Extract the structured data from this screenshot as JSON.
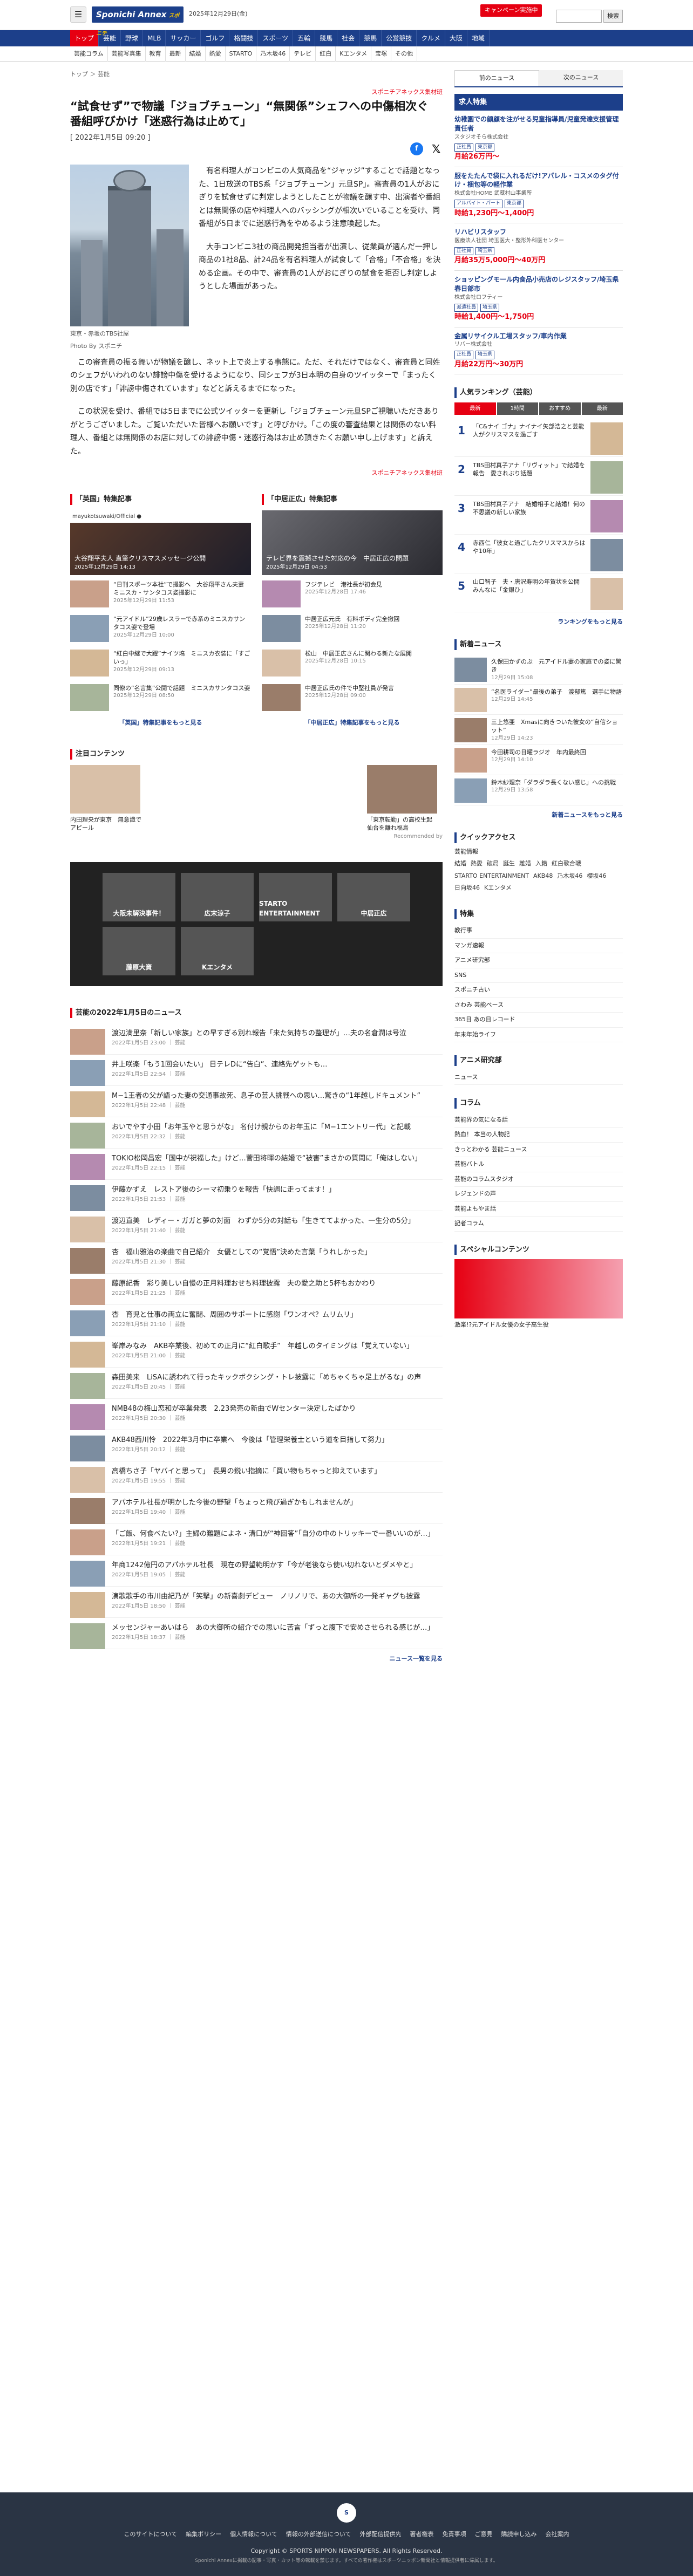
{
  "header": {
    "menu_icon": "☰",
    "logo": "Sponichi Annex",
    "logo_sub": "スポニチ",
    "date": "2025年12月29日(金)",
    "campaign": "キャンペーン実施中",
    "search_btn": "検索"
  },
  "nav": [
    "トップ",
    "芸能",
    "野球",
    "MLB",
    "サッカー",
    "ゴルフ",
    "格闘技",
    "スポーツ",
    "五輪",
    "競馬",
    "社会",
    "競馬",
    "公営競技",
    "クルメ",
    "大阪",
    "地域"
  ],
  "subnav": [
    "芸能コラム",
    "芸能写真集",
    "教育",
    "最新",
    "結婚",
    "熱愛",
    "STARTO",
    "乃木坂46",
    "テレビ",
    "紅白",
    "Kエンタメ",
    "宝塚",
    "その他"
  ],
  "breadcrumb": "トップ ＞ 芸能",
  "sponsor": "スポニチアネックス集材班",
  "title": "“試食せず”で物議「ジョブチューン」“無関係”シェフへの中傷相次ぐ　番組呼びかけ「迷惑行為は止めて」",
  "pubdate": "[ 2022年1月5日 09:20 ]",
  "photo_caption": "東京・赤坂のTBS社屋",
  "photo_credit": "Photo By スポニチ",
  "paras": [
    "有名料理人がコンビニの人気商品を“ジャッジ”することで話題となった、1日放送のTBS系「ジョブチューン」元旦SP」。審査員の1人がおにぎりを試食せずに判定しようとしたことが物議を醸す中、出演者や番組とは無関係の店や料理人へのバッシングが相次いでいることを受け、同番組が5日までに迷惑行為をやめるよう注意喚起した。",
    "大手コンビニ3社の商品開発担当者が出演し、従業員が選んだ一押し商品の1社8品、計24品を有名料理人が試食して「合格」「不合格」を決める企画。その中で、審査員の1人がおにぎりの試食を拒否し判定しようとした場面があった。",
    "この審査員の振る舞いが物議を醸し、ネット上で炎上する事態に。ただ、それだけではなく、審査員と同姓のシェフがいわれのない誹謗中傷を受けるようになり、同シェフが3日本明の自身のツイッターで「まったく別の店です」「誹謗中傷されています」などと訴えるまでになった。",
    "この状況を受け、番組では5日までに公式ツイッターを更新し「ジョブチューン元旦SPご視聴いただきありがとうございました。ご覧いただいた皆様へお願いです」と呼びかけ。「この度の審査結果とは関係のない料理人、番組とは無関係のお店に対しての誹謗中傷・迷惑行為はお止め頂きたくお願い申し上げます」と訴えた。"
  ],
  "left_col": {
    "head": "「英国」特集記事",
    "hero": "大谷翔平夫人 直筆クリスマスメッセージ公開",
    "hero_date": "2025年12月29日 14:13",
    "items": [
      {
        "t": "“日刊スポーツ本社”で撮影へ　大谷翔平さん夫妻　ミニスカ・サンタコス姿撮影に",
        "d": "2025年12月29日 11:53"
      },
      {
        "t": "“元アイドル”29歳レスラーで赤系のミニスカサンタコス姿で登場",
        "d": "2025年12月29日 10:00"
      },
      {
        "t": "“紅白中継で大躍”ナイツ塙　ミニスカ衣装に「すごいっ」",
        "d": "2025年12月29日 09:13"
      },
      {
        "t": "同僚の“名言集”公開で話題　ミニスカサンタコス姿",
        "d": "2025年12月29日 08:50"
      }
    ],
    "more": "「英国」特集記事をもっと見る"
  },
  "right_col": {
    "head": "「中居正広」特集記事",
    "hero": "テレビ界を震撼させた対応の今　中居正広の問題",
    "hero_date": "2025年12月29日 04:53",
    "items": [
      {
        "t": "フジテレビ　港社長が初会見",
        "d": "2025年12月28日 17:46"
      },
      {
        "t": "中居正広元氏　有料ボディ完全撤回",
        "d": "2025年12月28日 11:20"
      },
      {
        "t": "松山　中居正広さんに関わる新たな展開",
        "d": "2025年12月28日 10:15"
      },
      {
        "t": "中居正広氏の件で中堅社員が発言",
        "d": "2025年12月28日 09:00"
      }
    ],
    "more": "「中居正広」特集記事をもっと見る"
  },
  "attention": {
    "head": "注目コンテンツ",
    "left": "内田理央が東京　無意識でアピール",
    "right": "「東京転勤」の高校生起　仙台を離れ福島",
    "credit": "Recommended by"
  },
  "gallery": [
    "大阪未解決事件！",
    "広末涼子",
    "STARTO ENTERTAINMENT",
    "中居正広",
    "藤原大資",
    "Kエンタメ"
  ],
  "news_head": "芸能の2022年1月5日のニュース",
  "news": [
    {
      "t": "渡辺満里奈「新しい家族」との早すぎる別れ報告「来た気持ちの整理が」…夫の名倉潤は号泣",
      "d": "2022年1月5日 23:00 ｜ 芸能"
    },
    {
      "t": "井上咲楽「もう1回会いたい」 日テレDに“告白”、連絡先ゲットも…",
      "d": "2022年1月5日 22:54 ｜ 芸能"
    },
    {
      "t": "M−1王者の父が語った妻の交通事故死、息子の芸人挑戦への思い…驚きの“1年越しドキュメント”",
      "d": "2022年1月5日 22:48 ｜ 芸能"
    },
    {
      "t": "おいでやす小田「お年玉やと思うがな」 名付け親からのお年玉に「M−1エントリー代」と記載",
      "d": "2022年1月5日 22:32 ｜ 芸能"
    },
    {
      "t": "TOKIO松岡昌宏「国中が祝福した」けど…菅田将暉の結婚で“被害”まさかの質問に「俺はしない」",
      "d": "2022年1月5日 22:15 ｜ 芸能"
    },
    {
      "t": "伊藤かずえ　レストア後のシーマ初乗りを報告「快調に走ってます！」",
      "d": "2022年1月5日 21:53 ｜ 芸能"
    },
    {
      "t": "渡辺直美　レディー・ガガと夢の対面　わずか5分の対話も「生きててよかった、一生分の5分」",
      "d": "2022年1月5日 21:40 ｜ 芸能"
    },
    {
      "t": "杏　福山雅治の楽曲で自己紹介　女優としての“覚悟”決めた言葉「うれしかった」",
      "d": "2022年1月5日 21:30 ｜ 芸能"
    },
    {
      "t": "藤原紀香　彩り美しい自慢の正月料理おせち料理披露　夫の愛之助と5杯もおかわり",
      "d": "2022年1月5日 21:25 ｜ 芸能"
    },
    {
      "t": "杏　育児と仕事の両立に奮闘、周囲のサポートに感謝「ワンオペ？ムリムリ」",
      "d": "2022年1月5日 21:10 ｜ 芸能"
    },
    {
      "t": "峯岸みなみ　AKB卒業後、初めての正月に“紅白歌手”　年越しのタイミングは「覚えていない」",
      "d": "2022年1月5日 21:00 ｜ 芸能"
    },
    {
      "t": "森田美来　LiSAに誘われて行ったキックボクシング・トレ披露に「めちゃくちゃ足上がるな」の声",
      "d": "2022年1月5日 20:45 ｜ 芸能"
    },
    {
      "t": "NMB48の梅山恋和が卒業発表　2.23発売の新曲でWセンター決定したばかり",
      "d": "2022年1月5日 20:30 ｜ 芸能"
    },
    {
      "t": "AKB48西川怜　2022年3月中に卒業へ　今後は「管理栄養士という道を目指して努力」",
      "d": "2022年1月5日 20:12 ｜ 芸能"
    },
    {
      "t": "高橋ちさ子「ヤバイと思って」　長男の鋭い指摘に「買い物もちゃっと抑えています」",
      "d": "2022年1月5日 19:55 ｜ 芸能"
    },
    {
      "t": "アパホテル社長が明かした今後の野望「ちょっと飛び過ぎかもしれませんが」",
      "d": "2022年1月5日 19:40 ｜ 芸能"
    },
    {
      "t": "「ご飯、何食べたい?」主婦の難題によネ・溝口が“神回答”「自分の中のトリッキーで一番いいのが…」",
      "d": "2022年1月5日 19:21 ｜ 芸能"
    },
    {
      "t": "年商1242億円のアパホテル社長　現在の野望範明かす「今が老後なら使い切れないとダメやと」",
      "d": "2022年1月5日 19:05 ｜ 芸能"
    },
    {
      "t": "演歌歌手の市川由紀乃が「笑撃」の新喜劇デビュー　ノリノリで、あの大御所の一発ギャグも披露",
      "d": "2022年1月5日 18:50 ｜ 芸能"
    },
    {
      "t": "メッセンジャーあいはら　あの大御所の紹介での思いに苦言「ずっと腹下で安めさせられる感じが…」",
      "d": "2022年1月5日 18:37 ｜ 芸能"
    }
  ],
  "news_more": "ニュース一覧を見る",
  "side": {
    "tabs": [
      "前のニュース",
      "次のニュース"
    ],
    "jobs_head": "求人特集",
    "jobs": [
      {
        "title": "幼稚園での顧顧を注がせる児童指導員/児童発達支援管理責任者",
        "co": "スタジオそら株式会社",
        "tag1": "正社員",
        "tag2": "東京都",
        "pay": "月給26万円〜"
      },
      {
        "title": "服をたたんで袋に入れるだけ!アパレル・コスメのタグ付け・梱包等の軽作業",
        "co": "株式会社HOME 武蔵村山事業所",
        "tag1": "アルバイト・パート",
        "tag2": "東京都",
        "pay": "時給1,230円〜1,400円"
      },
      {
        "title": "リハビリスタッフ",
        "co": "医療法人社団 埼玉医大・整形外科医センター",
        "tag1": "正社員",
        "tag2": "埼玉県",
        "pay": "月給35万5,000円〜40万円"
      },
      {
        "title": "ショッピングモール内食品小売店のレジスタッフ/埼玉県春日部市",
        "co": "株式会社ロフティー",
        "tag1": "派遣社員",
        "tag2": "埼玉県",
        "pay": "時給1,400円〜1,750円"
      },
      {
        "title": "金属リサイクル工場スタッフ/車内作業",
        "co": "リバー株式会社",
        "tag1": "正社員",
        "tag2": "埼玉県",
        "pay": "月給22万円〜30万円"
      }
    ],
    "rank_head": "人気ランキング（芸能）",
    "rank_tabs": [
      "最新",
      "1時間",
      "おすすめ",
      "最新"
    ],
    "rank": [
      "「C&ナイ ゴナ」ナイナイ矢部浩之と芸能人がクリスマスを過ごす",
      "TBS田村真子アナ「リヴィット」で結婚を報告　愛されぶり話題",
      "TBS田村真子アナ　結婚相手と結婚！何の不思議の新しい家族",
      "赤西仁「彼女と過ごしたクリスマスからはや10年」",
      "山口智子　夫・唐沢寿明の年賀状を公開　みんなに「金銀ひ」"
    ],
    "rank_more": "ランキングをもっと見る",
    "sn_head": "新着ニュース",
    "sn": [
      {
        "t": "久保田かずのぶ　元アイドル妻の家庭での姿に驚き",
        "d": "12月29日 15:08"
      },
      {
        "t": "“名医ライダー”最後の弟子　渡部篤　選手に物語",
        "d": "12月29日 14:45"
      },
      {
        "t": "三上悠亜　Xmasに向きついた彼女の“自信ショット”",
        "d": "12月29日 14:23"
      },
      {
        "t": "今田耕司の日曜ラジオ　年内最終回",
        "d": "12月29日 14:10"
      },
      {
        "t": "鈴木紗理奈「ダラダラ長くない感じ」への挑戦",
        "d": "12月29日 13:58"
      }
    ],
    "sn_more": "新着ニュースをもっと見る",
    "qa_head": "クイックアクセス",
    "qa_sub": "芸能情報",
    "qa": [
      "結婚",
      "熱愛",
      "破局",
      "誕生",
      "離婚",
      "入籍",
      "紅白歌合戦",
      "STARTO ENTERTAINMENT",
      "AKB48",
      "乃木坂46",
      "櫻坂46",
      "日向坂46",
      "Kエンタメ"
    ],
    "tokushu_head": "特集",
    "tokushu": [
      "教行事",
      "マンガ速報",
      "アニメ研究部",
      "SNS",
      "スポニチ占い",
      "さわみ 芸能ベース",
      "365日 あの日レコード",
      "年末年始ライフ"
    ],
    "anime_head": "アニメ研究部",
    "anime": [
      "ニュース"
    ],
    "column_head": "コラム",
    "column": [
      "芸能界の気になる話",
      "熱血！ 本当の人物記",
      "きっとわかる 芸能ニュース",
      "芸能バトル",
      "芸能のコラムスタジオ",
      "レジェンドの声",
      "芸能よもやま話",
      "記者コラム"
    ],
    "special_head": "スペシャルコンテンツ",
    "special_t": "激楽!?元アイドル女優の女子高生役"
  },
  "footer": {
    "logo": "S",
    "links": [
      "このサイトについて",
      "編集ポリシー",
      "個人情報について",
      "情報の外部送信について",
      "外部配信提供先",
      "著者権表",
      "免責事項",
      "ご意見",
      "購読申し込み",
      "会社案内"
    ],
    "copy": "Copyright © SPORTS NIPPON NEWSPAPERS. All Rights Reserved.",
    "copy2": "Sponichi Annexに掲載の記事・写真・カット等の転載を禁じます。すべての著作権はスポーツニッポン新聞社と情報提供者に帰属します。"
  }
}
